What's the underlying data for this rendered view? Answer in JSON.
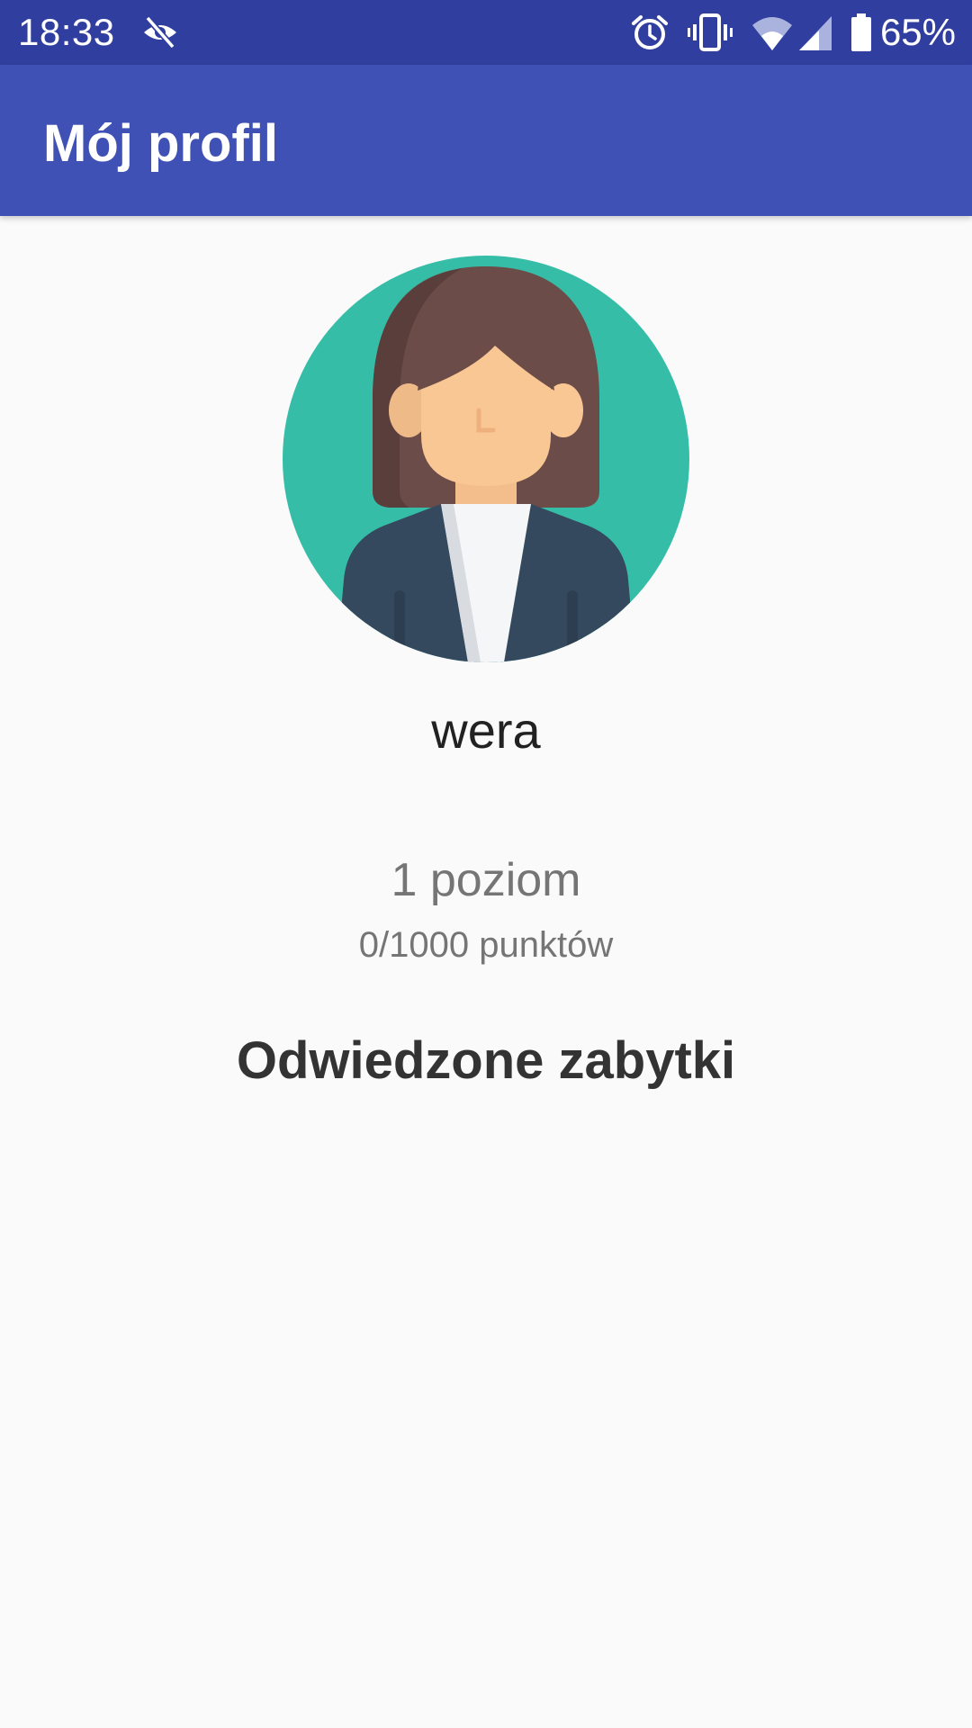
{
  "status_bar": {
    "time": "18:33",
    "battery_percent": "65%",
    "icons": [
      "eye-off-icon",
      "alarm-icon",
      "vibrate-icon",
      "wifi-icon",
      "cell-signal-icon",
      "battery-icon"
    ],
    "background": "#303f9f"
  },
  "app_bar": {
    "title": "Mój profil",
    "background": "#3f51b5"
  },
  "profile": {
    "avatar_icon": "female-avatar-icon",
    "avatar_background": "#36bda7",
    "username": "wera",
    "level": "1 poziom",
    "points": "0/1000 punktów"
  },
  "visited": {
    "title": "Odwiedzone zabytki"
  }
}
